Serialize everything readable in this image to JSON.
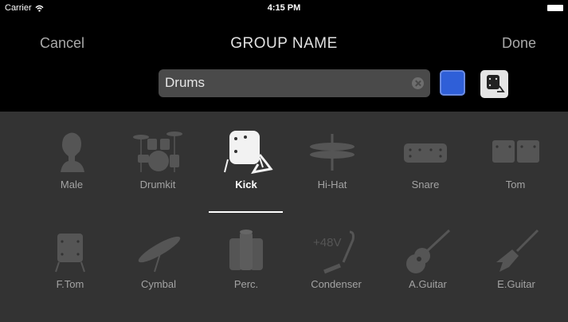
{
  "status_bar": {
    "carrier": "Carrier",
    "time": "4:15 PM"
  },
  "nav": {
    "cancel": "Cancel",
    "title": "GROUP NAME",
    "done": "Done"
  },
  "name_field": {
    "value": "Drums"
  },
  "color_swatch": "#2f5fd8",
  "icons": [
    {
      "label": "Male",
      "icon": "male-icon"
    },
    {
      "label": "Drumkit",
      "icon": "drumkit-icon"
    },
    {
      "label": "Kick",
      "icon": "kick-icon",
      "selected": true
    },
    {
      "label": "Hi-Hat",
      "icon": "hihat-icon"
    },
    {
      "label": "Snare",
      "icon": "snare-icon"
    },
    {
      "label": "Tom",
      "icon": "tom-icon"
    },
    {
      "label": "F.Tom",
      "icon": "floor-tom-icon"
    },
    {
      "label": "Cymbal",
      "icon": "cymbal-icon"
    },
    {
      "label": "Perc.",
      "icon": "percussion-icon"
    },
    {
      "label": "Condenser",
      "icon": "condenser-mic-icon",
      "text": "+48V"
    },
    {
      "label": "A.Guitar",
      "icon": "acoustic-guitar-icon"
    },
    {
      "label": "E.Guitar",
      "icon": "electric-guitar-icon"
    }
  ]
}
